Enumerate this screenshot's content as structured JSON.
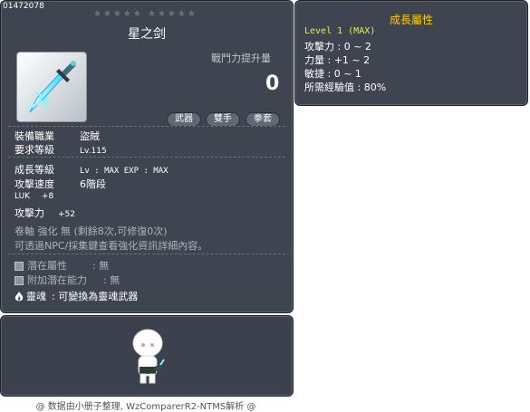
{
  "item": {
    "id": "01472078",
    "stars": "★★★★★ ★★★★★",
    "name": "星之剑",
    "attack_power_label": "戰鬥力提升量",
    "attack_power_value": "0",
    "tags": [
      "武器",
      "雙手",
      "拳套"
    ],
    "job_label": "裝備職業",
    "job_value": "盜賊",
    "req_level_label": "要求等級",
    "req_level_value": "Lv.115",
    "growth_level_label": "成長等級",
    "growth_level_value": "Lv : MAX   EXP : MAX",
    "attack_speed_label": "攻擊速度",
    "attack_speed_value": "6階段",
    "luk_label": "LUK",
    "luk_value": "+8",
    "atk_label": "攻擊力",
    "atk_value": "+52",
    "scroll_text": "卷軸 強化 無 (剩餘8次,可修復0次)",
    "hint_text": "可透過NPC/採集鍵查看強化資訊詳細內容。",
    "potential_label": "潛在屬性",
    "potential_value": ": 無",
    "bonus_potential_label": "附加潛在能力",
    "bonus_potential_value": ": 無",
    "soul_label": "靈魂",
    "soul_value": ":   可變換為靈魂武器"
  },
  "growth_panel": {
    "title": "成長屬性",
    "level_line": "Level 1 (MAX)",
    "lines": [
      "攻擊力 : 0 ~ 2",
      "力量 : +1 ~ 2",
      "敏捷 : 0 ~ 1",
      "所需經驗值 : 80%"
    ]
  },
  "footer": "@ 数据由小册子整理, WzComparerR2-NTMS解析 @",
  "colors": {
    "panel_bg": "#3f4550",
    "title_gold": "#ffcc00",
    "level_green": "#d9f250",
    "icon_blue": "#46e6ff"
  }
}
